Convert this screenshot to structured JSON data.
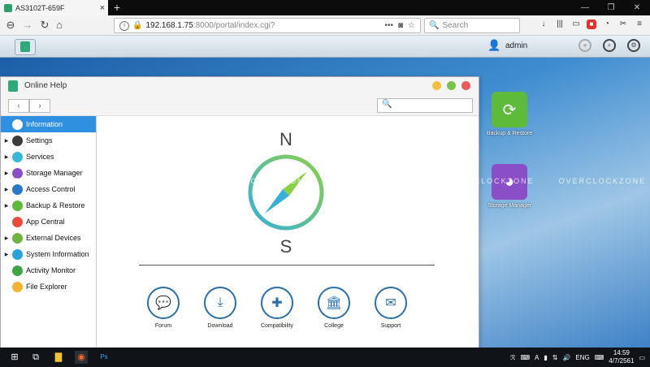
{
  "browser": {
    "tab_title": "AS3102T-659F",
    "tab_close": "×",
    "new_tab": "+",
    "url_host": "192.168.1.75",
    "url_rest": ":8000/portal/index.cgi?",
    "search_placeholder": "Search",
    "window_controls": [
      "—",
      "❐",
      "✕"
    ]
  },
  "nas": {
    "username": "admin"
  },
  "desktop": {
    "icons": [
      {
        "label": "Backup & Restore",
        "color": "#5dba3a"
      },
      {
        "label": "Storage Manager",
        "color": "#8a4fc6"
      }
    ],
    "watermark": "OVERCLOCKZONE"
  },
  "help_window": {
    "title": "Online Help",
    "sidebar": [
      {
        "label": "Information",
        "active": true,
        "expandable": false,
        "color": "#2f8fe0"
      },
      {
        "label": "Settings",
        "active": false,
        "expandable": true,
        "color": "#3b3b3b"
      },
      {
        "label": "Services",
        "active": false,
        "expandable": true,
        "color": "#3bb6d8"
      },
      {
        "label": "Storage Manager",
        "active": false,
        "expandable": true,
        "color": "#8a4fc6"
      },
      {
        "label": "Access Control",
        "active": false,
        "expandable": true,
        "color": "#2b78c8"
      },
      {
        "label": "Backup & Restore",
        "active": false,
        "expandable": true,
        "color": "#5dba3a"
      },
      {
        "label": "App Central",
        "active": false,
        "expandable": false,
        "color": "#e94b3c"
      },
      {
        "label": "External Devices",
        "active": false,
        "expandable": true,
        "color": "#6fb43f"
      },
      {
        "label": "System Information",
        "active": false,
        "expandable": true,
        "color": "#2aa0dc"
      },
      {
        "label": "Activity Monitor",
        "active": false,
        "expandable": false,
        "color": "#3ea544"
      },
      {
        "label": "File Explorer",
        "active": false,
        "expandable": false,
        "color": "#f3b42f"
      }
    ],
    "compass_n": "N",
    "compass_s": "S",
    "links": [
      {
        "label": "Forum",
        "glyph": "💬"
      },
      {
        "label": "Download",
        "glyph": "⤓"
      },
      {
        "label": "Compatibility",
        "glyph": "✚"
      },
      {
        "label": "College",
        "glyph": "🏛"
      },
      {
        "label": "Support",
        "glyph": "✉"
      }
    ]
  },
  "taskbar": {
    "language": "ENG",
    "time": "14:59",
    "date": "4/7/2561"
  }
}
